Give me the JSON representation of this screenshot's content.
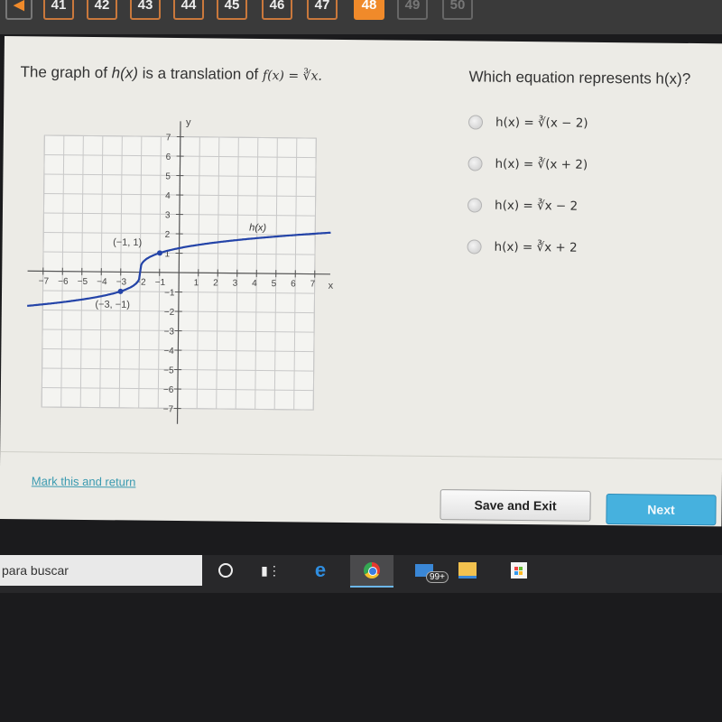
{
  "nav": {
    "back_icon": "chevron-left-icon",
    "questions": [
      {
        "label": "41",
        "state": "answered"
      },
      {
        "label": "42",
        "state": "answered"
      },
      {
        "label": "43",
        "state": "answered"
      },
      {
        "label": "44",
        "state": "answered"
      },
      {
        "label": "45",
        "state": "answered"
      },
      {
        "label": "46",
        "state": "answered"
      },
      {
        "label": "47",
        "state": "answered"
      },
      {
        "label": "48",
        "state": "current"
      },
      {
        "label": "49",
        "state": "disabled"
      },
      {
        "label": "50",
        "state": "disabled"
      }
    ],
    "accent_color": "#f08a2a"
  },
  "prompt": {
    "part1": "The graph of ",
    "hx": "h(x)",
    "part2": " is a translation of ",
    "fx": "f(x) = ∛x."
  },
  "question": {
    "text": "Which equation represents h(x)?"
  },
  "options": [
    {
      "label": "h(x) = ∛(x − 2)",
      "selected": false
    },
    {
      "label": "h(x) = ∛(x + 2)",
      "selected": false
    },
    {
      "label": "h(x) = ∛x − 2",
      "selected": false
    },
    {
      "label": "h(x) = ∛x + 2",
      "selected": false
    }
  ],
  "graph": {
    "x_label": "x",
    "y_label": "y",
    "x_ticks": [
      "−7",
      "−6",
      "−5",
      "−4",
      "−3",
      "−2",
      "−1",
      "1",
      "2",
      "3",
      "4",
      "5",
      "6",
      "7"
    ],
    "y_ticks": [
      "7",
      "6",
      "5",
      "4",
      "3",
      "2",
      "1",
      "−1",
      "−2",
      "−3",
      "−4",
      "−5",
      "−6",
      "−7"
    ],
    "x_range": [
      -7,
      7
    ],
    "y_range": [
      -7,
      7
    ],
    "curve_label": "h(x)",
    "curve_color": "#2444a8",
    "points": [
      {
        "x": -1,
        "y": 1,
        "label": "(−1, 1)"
      },
      {
        "x": -3,
        "y": -1,
        "label": "(−3, −1)"
      }
    ],
    "function": "cbrt(x+2)"
  },
  "footer": {
    "mark_label": "Mark this and return",
    "save_label": "Save and Exit",
    "next_label": "Next",
    "next_color": "#46b1de"
  },
  "taskbar": {
    "search_text": "para buscar",
    "icons": [
      "cortana-icon",
      "task-view-icon",
      "edge-icon",
      "chrome-icon",
      "mail-icon",
      "file-explorer-icon",
      "store-icon"
    ],
    "mail_badge": "99+"
  }
}
